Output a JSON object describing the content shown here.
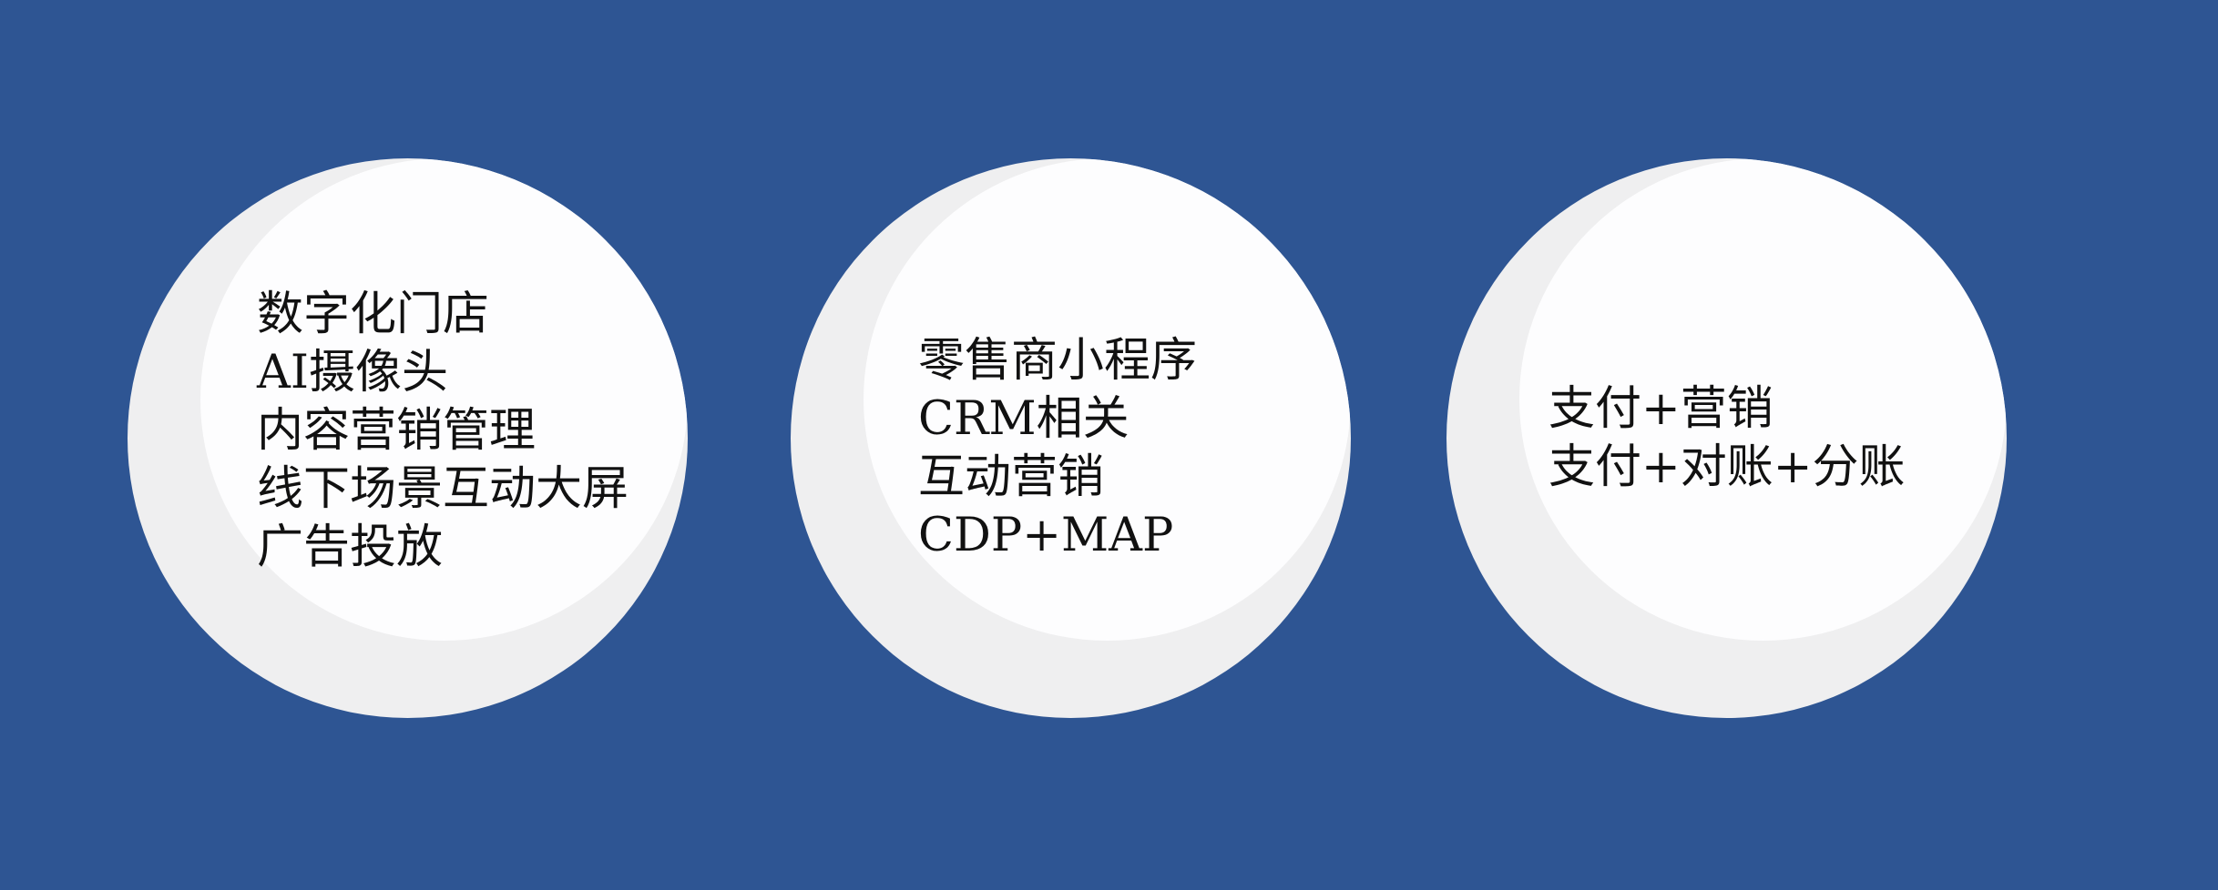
{
  "colors": {
    "background": "#2e5593",
    "bubble_shadow": "#efeff0",
    "bubble_face": "#fdfdfe",
    "text": "#111111"
  },
  "bubbles": [
    {
      "lines": [
        "数字化门店",
        "AI摄像头",
        "内容营销管理",
        "线下场景互动大屏",
        "广告投放"
      ]
    },
    {
      "lines": [
        "零售商小程序",
        "CRM相关",
        "互动营销",
        "CDP+MAP"
      ]
    },
    {
      "lines": [
        "支付+营销",
        "支付+对账+分账"
      ]
    }
  ]
}
